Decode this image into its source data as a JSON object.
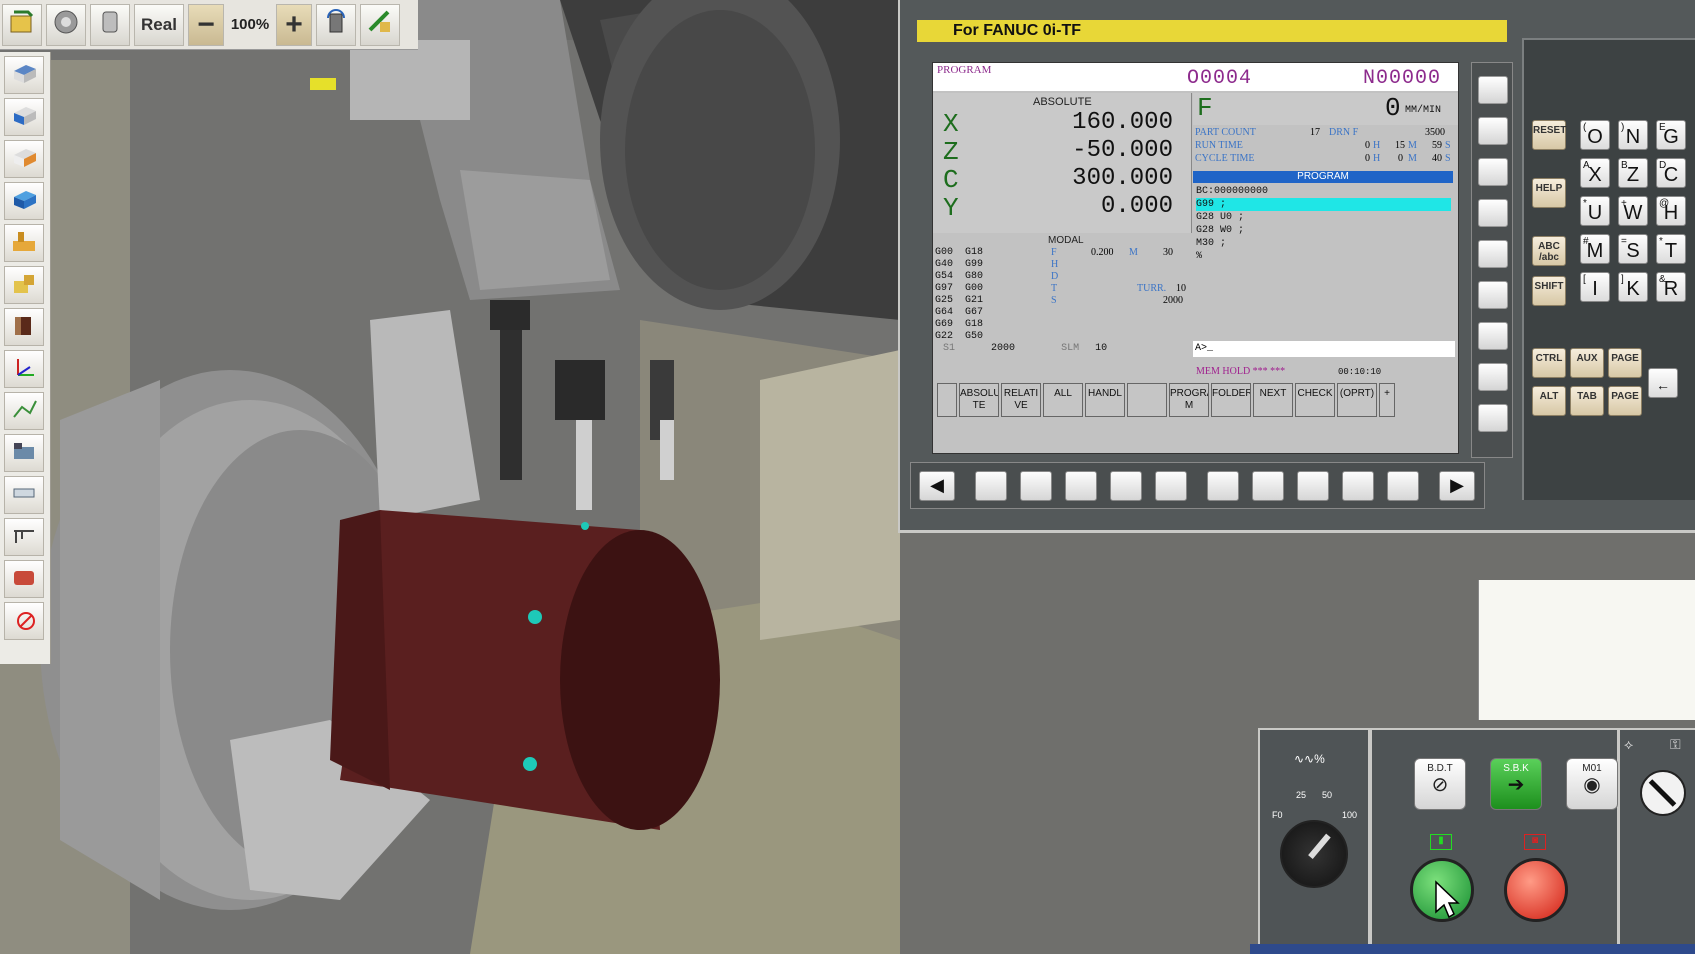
{
  "toolbar": {
    "real_label": "Real",
    "zoom_minus": "−",
    "zoom_level": "100%",
    "zoom_plus": "+"
  },
  "cnc": {
    "title": "For FANUC 0i-TF",
    "screen": {
      "mode_label": "PROGRAM",
      "program_number": "O0004",
      "sequence_number": "N00000",
      "absolute_label": "ABSOLUTE",
      "axes": [
        {
          "axis": "X",
          "value": "160.000"
        },
        {
          "axis": "Z",
          "value": "-50.000"
        },
        {
          "axis": "C",
          "value": "300.000"
        },
        {
          "axis": "Y",
          "value": "0.000"
        }
      ],
      "feed_label": "F",
      "feed_value": "0",
      "feed_unit": "MM/MIN",
      "part_count_label": "PART COUNT",
      "part_count": "17",
      "drn_label": "DRN F",
      "drn_value": "3500",
      "run_time_label": "RUN TIME",
      "run_time": {
        "h": "0",
        "m": "15",
        "s": "59"
      },
      "cycle_time_label": "CYCLE TIME",
      "cycle_time": {
        "h": "0",
        "m": "0",
        "s": "40"
      },
      "program_bar": "PROGRAM",
      "program_lines": [
        "BC:000000000",
        "G99 ;",
        "G28 U0 ;",
        "G28 W0 ;",
        "M30 ;",
        "%"
      ],
      "modal_label": "MODAL",
      "modal_rows": [
        [
          "G00",
          "G18"
        ],
        [
          "G40",
          "G99"
        ],
        [
          "G54",
          "G80"
        ],
        [
          "G97",
          "G00"
        ],
        [
          "G25",
          "G21"
        ],
        [
          "G64",
          "G67"
        ],
        [
          "G69",
          "G18"
        ],
        [
          "G22",
          "G50"
        ]
      ],
      "modal_f_value": "0.200",
      "modal_m_value": "30",
      "modal_turr_label": "TURR.",
      "modal_turr_value": "10",
      "modal_s_value": "2000",
      "s1_label": "S1",
      "s1_value": "2000",
      "slm_label": "SLM",
      "slm_value": "10",
      "input_prompt": "A>_",
      "status_text": "MEM HOLD *** ***",
      "clock": "00:10:10",
      "softkeys": [
        "ABSOLU TE",
        "RELATI VE",
        "ALL",
        "HANDL",
        "",
        "PROGRA M",
        "FOLDER",
        "NEXT",
        "CHECK",
        "(OPRT)",
        "+"
      ]
    },
    "keypad": {
      "reset": "RESET",
      "help": "HELP",
      "abc": "ABC /abc",
      "shift": "SHIFT",
      "ctrl": "CTRL",
      "aux": "AUX",
      "alt": "ALT",
      "tab": "TAB",
      "page_up": "PAGE",
      "page_down": "PAGE",
      "letters": [
        {
          "main": "O",
          "sub": "("
        },
        {
          "main": "N",
          "sub": ")"
        },
        {
          "main": "G",
          "sub": "E"
        },
        {
          "main": "X",
          "sub": "A"
        },
        {
          "main": "Z",
          "sub": "B"
        },
        {
          "main": "C",
          "sub": "D"
        },
        {
          "main": "U",
          "sub": "*"
        },
        {
          "main": "W",
          "sub": "+"
        },
        {
          "main": "H",
          "sub": "@"
        },
        {
          "main": "M",
          "sub": "#"
        },
        {
          "main": "S",
          "sub": "="
        },
        {
          "main": "T",
          "sub": "*"
        },
        {
          "main": "I",
          "sub": "["
        },
        {
          "main": "K",
          "sub": "]"
        },
        {
          "main": "R",
          "sub": "&"
        }
      ]
    }
  },
  "operator": {
    "feed_override_label": "%",
    "dial_ticks": [
      "F0",
      "25",
      "50",
      "100"
    ],
    "bdt_label": "B.D.T",
    "sbk_label": "S.B.K",
    "m01_label": "M01"
  }
}
